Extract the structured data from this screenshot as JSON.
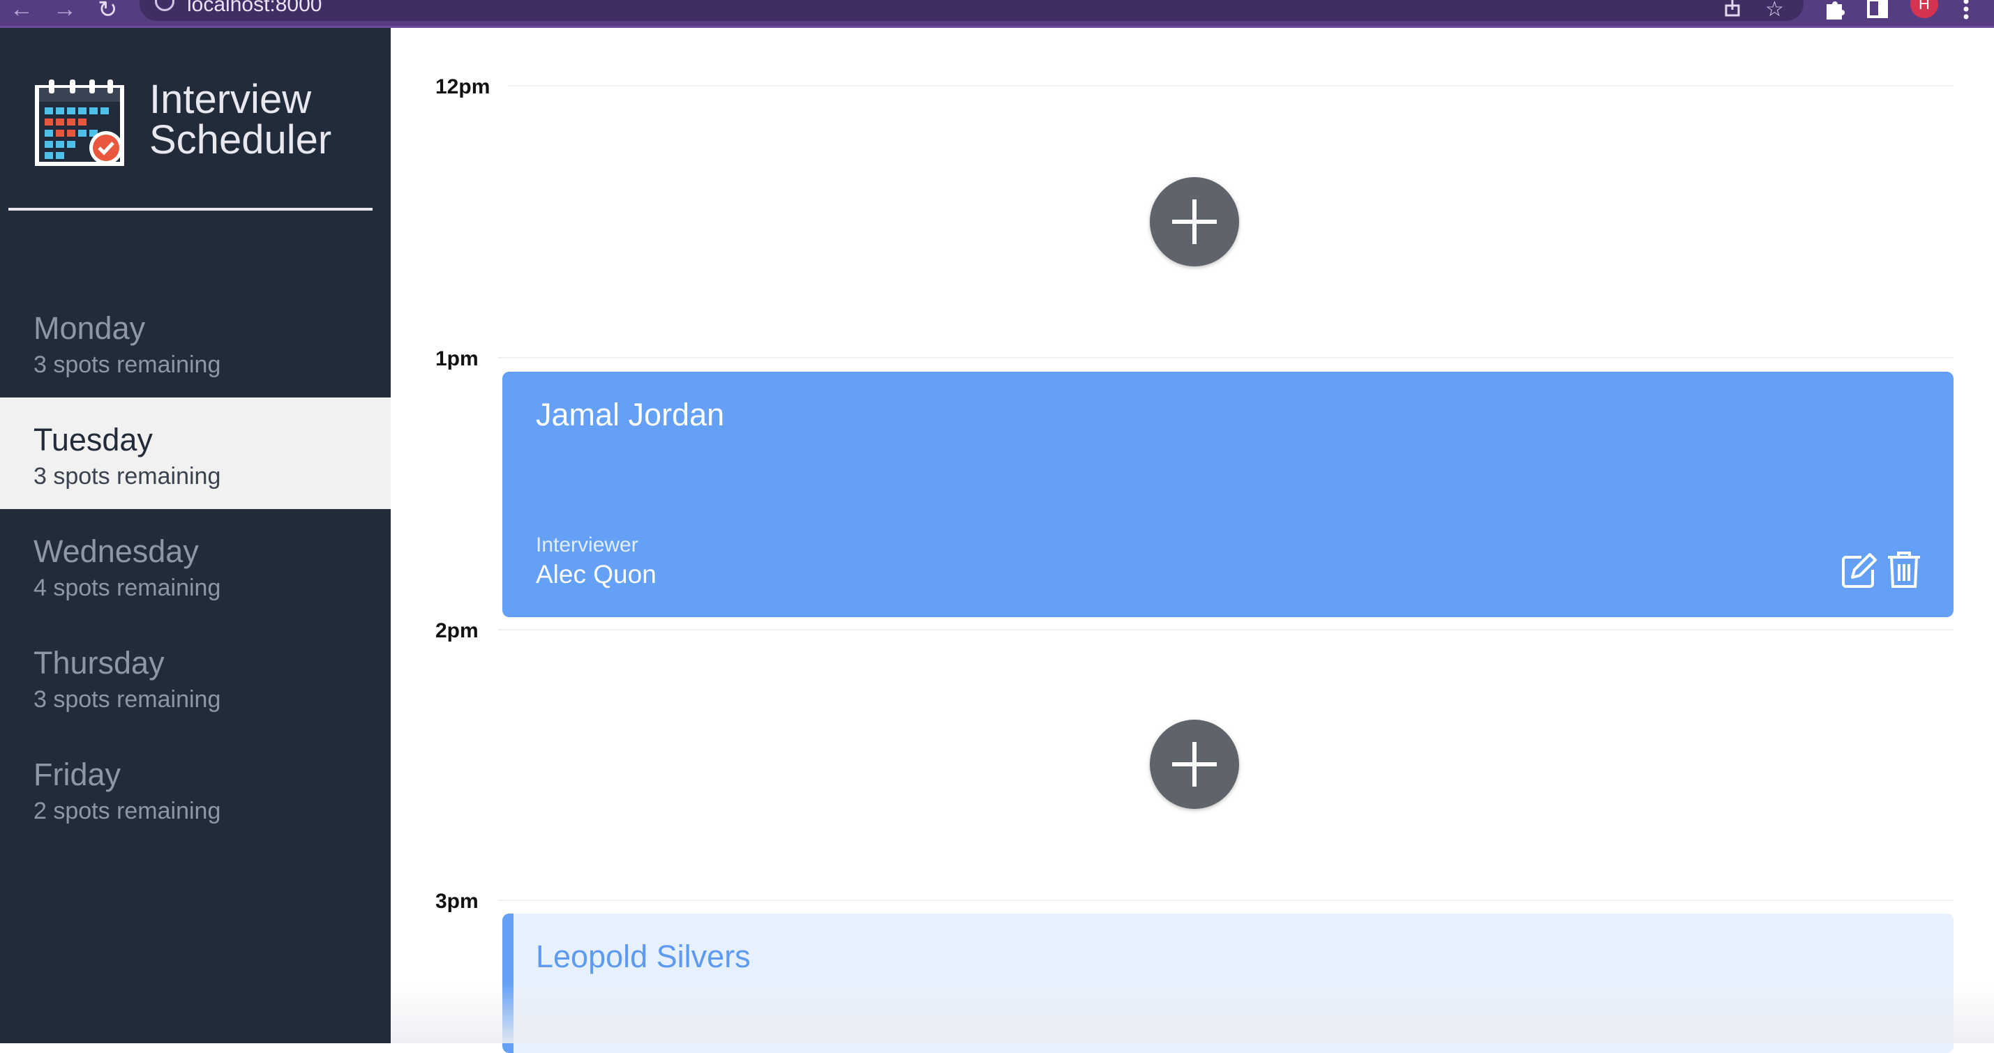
{
  "browser": {
    "url": "localhost:8000",
    "back_icon": "←",
    "forward_icon": "→",
    "reload_icon": "↻",
    "star_icon": "☆",
    "avatar_letter": "H"
  },
  "sidebar": {
    "logo_line1": "Interview",
    "logo_line2": "Scheduler",
    "days": [
      {
        "name": "Monday",
        "spots": "3 spots remaining"
      },
      {
        "name": "Tuesday",
        "spots": "3 spots remaining"
      },
      {
        "name": "Wednesday",
        "spots": "4 spots remaining"
      },
      {
        "name": "Thursday",
        "spots": "3 spots remaining"
      },
      {
        "name": "Friday",
        "spots": "2 spots remaining"
      }
    ],
    "selected_day": "Tuesday"
  },
  "schedule": {
    "slots": [
      "12pm",
      "1pm",
      "2pm",
      "3pm"
    ],
    "appointment_1": {
      "student": "Jamal Jordan",
      "interviewer_label": "Interviewer",
      "interviewer": "Alec Quon"
    },
    "appointment_2": {
      "student": "Leopold Silvers"
    }
  },
  "colors": {
    "sidebar_bg": "#222b3a",
    "selected_bg": "#f1f1f1",
    "card_blue": "#64a0f6",
    "add_button": "#5f636b",
    "browser_purple": "#563c80"
  }
}
